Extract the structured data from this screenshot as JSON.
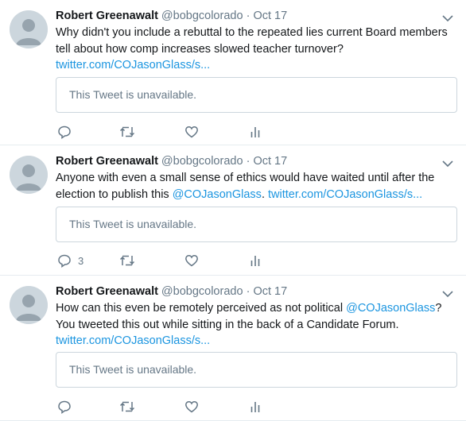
{
  "tweets": [
    {
      "name": "Robert Greenawalt",
      "handle": "@bobgcolorado",
      "separator": "·",
      "date": "Oct 17",
      "text_line1": "Why didn't you include a rebuttal to the repeated lies current Board members",
      "text_line2": "tell about how comp increases slowed teacher turnover?",
      "link": "twitter.com/COJasonGlass/s...",
      "quote_text": "This Tweet is unavailable.",
      "reply_count": ""
    },
    {
      "name": "Robert Greenawalt",
      "handle": "@bobgcolorado",
      "separator": "·",
      "date": "Oct 17",
      "text_line1": "Anyone with even a small sense of ethics would have waited until after the",
      "text_line2_prefix": "election to publish this ",
      "mention": "@COJasonGlass",
      "text_line2_mid": ". ",
      "link": "twitter.com/COJasonGlass/s...",
      "quote_text": "This Tweet is unavailable.",
      "reply_count": "3"
    },
    {
      "name": "Robert Greenawalt",
      "handle": "@bobgcolorado",
      "separator": "·",
      "date": "Oct 17",
      "text_line1_prefix": "How can this even be remotely perceived as not political ",
      "mention": "@COJasonGlass",
      "text_line1_suffix": "?",
      "text_line2": "You tweeted this out while sitting in the back of a Candidate Forum.",
      "link": "twitter.com/COJasonGlass/s...",
      "quote_text": "This Tweet is unavailable.",
      "reply_count": ""
    }
  ],
  "icons": {
    "reply": "reply-icon",
    "retweet": "retweet-icon",
    "like": "like-icon",
    "analytics": "analytics-icon",
    "caret": "chevron-down-icon",
    "avatar": "default-avatar-icon"
  },
  "colors": {
    "link": "#1b95e0",
    "secondary_text": "#657786",
    "border": "#e6ecf0",
    "quote_border": "#ccd6dd"
  }
}
